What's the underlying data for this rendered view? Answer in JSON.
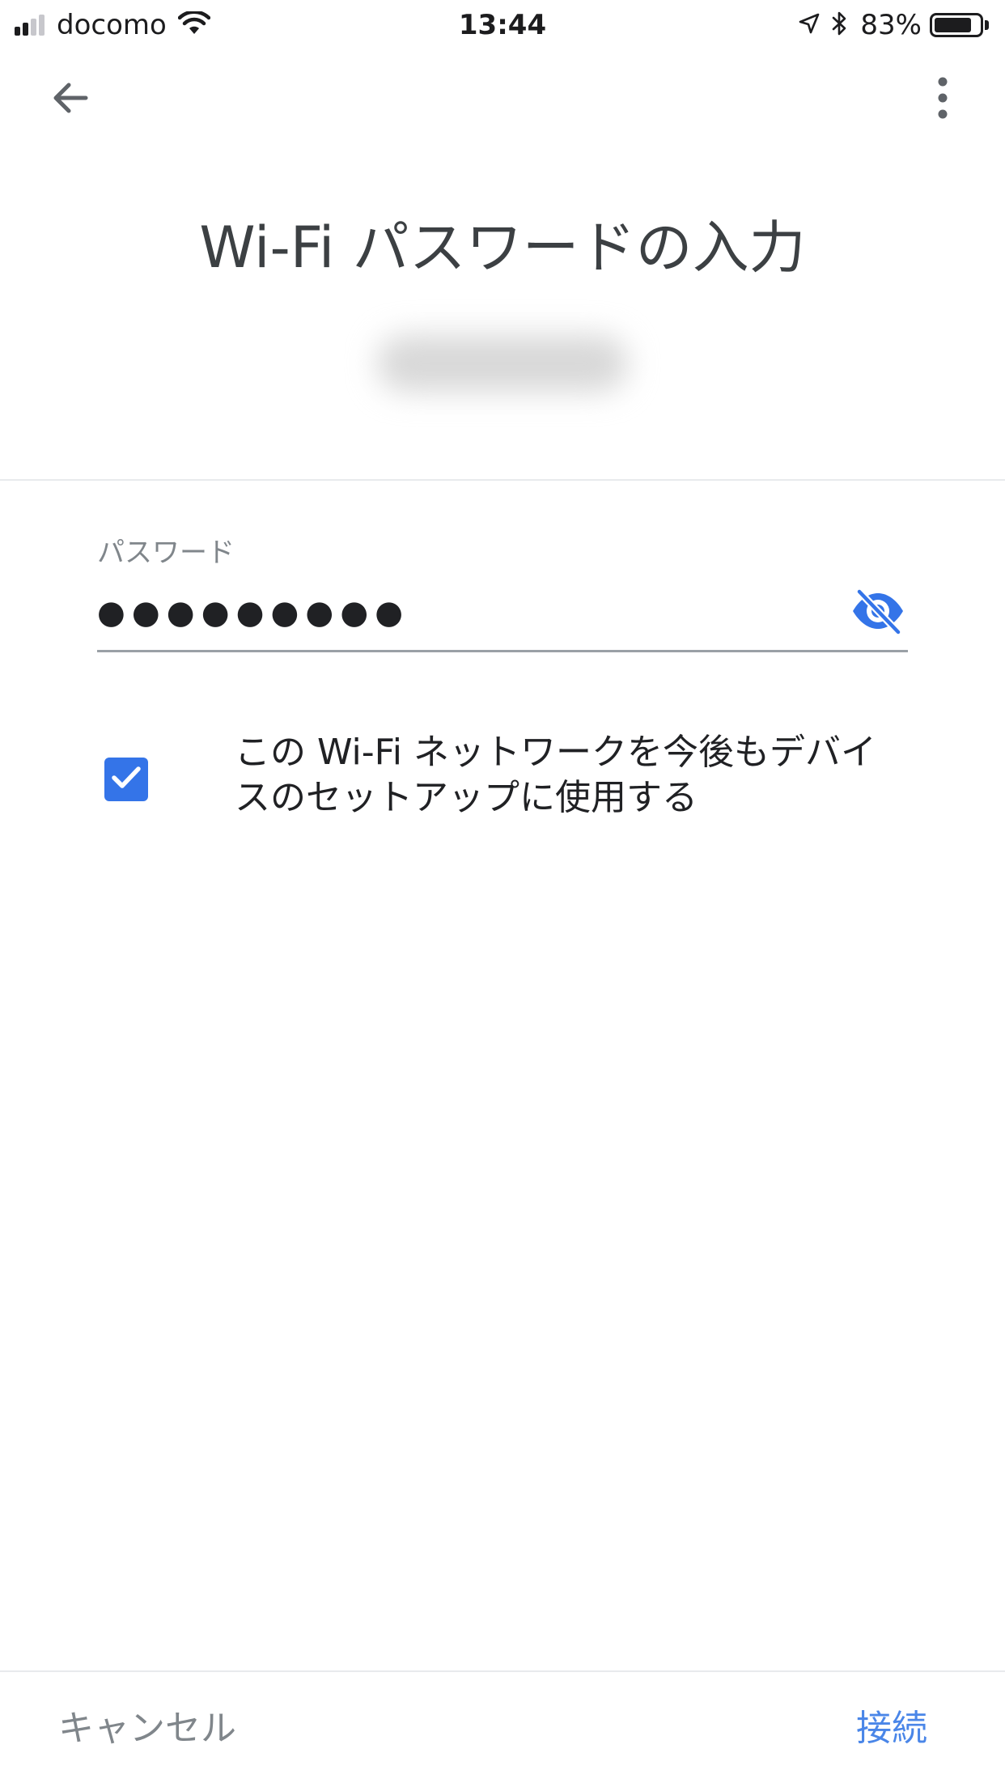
{
  "status_bar": {
    "carrier": "docomo",
    "time": "13:44",
    "battery_percent": "83%",
    "battery_level": 0.83,
    "signal_bars_active": 2,
    "signal_bars_total": 4,
    "icons": [
      "signal-icon",
      "wifi-icon",
      "location-arrow-icon",
      "bluetooth-icon",
      "battery-icon"
    ]
  },
  "app_bar": {
    "back_icon": "arrow-back-icon",
    "more_icon": "more-vert-icon"
  },
  "header": {
    "title": "Wi-Fi パスワードの入力"
  },
  "password_field": {
    "label": "パスワード",
    "value": "●●●●●●●●●",
    "visibility_icon": "eye-off-icon"
  },
  "remember_network": {
    "checked": true,
    "label": "この Wi-Fi ネットワークを今後もデバイスのセットアップに使用する"
  },
  "actions": {
    "cancel_label": "キャンセル",
    "connect_label": "接続"
  },
  "colors": {
    "accent": "#4a86e8",
    "checkbox": "#3474e8",
    "text_primary": "#202124",
    "text_secondary": "#80868b"
  }
}
